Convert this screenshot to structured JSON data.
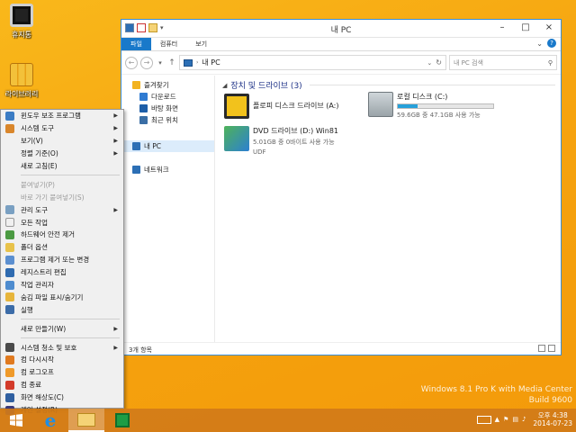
{
  "desktop": {
    "icons": [
      {
        "label": "휴지통",
        "icon": "recycle-bin-icon"
      },
      {
        "label": "라이브러리",
        "icon": "library-icon"
      }
    ],
    "watermark": {
      "line1": "Windows 8.1 Pro K with Media Center",
      "line2": "Build 9600"
    }
  },
  "explorer": {
    "title": "내 PC",
    "ribbon_tabs": [
      "파일",
      "컴퓨터",
      "보기"
    ],
    "help": "?",
    "address_path": "내 PC",
    "search_placeholder": "내 PC 검색",
    "nav": {
      "favorites": "즐겨찾기",
      "downloads": "다운로드",
      "desktop": "바탕 화면",
      "recent": "최근 위치",
      "this_pc": "내 PC",
      "network": "네트워크"
    },
    "section_title": "장치 및 드라이브 (3)",
    "drives": [
      {
        "name": "플로피 디스크 드라이브 (A:)",
        "sub": "",
        "icon": "floppy-drive-icon"
      },
      {
        "name": "로컬 디스크 (C:)",
        "sub": "59.6GB 중 47.1GB 사용 가능",
        "icon": "local-disk-icon",
        "used_fraction": 0.21
      },
      {
        "name": "DVD 드라이브 (D:) Win81",
        "sub": "5.01GB 중 0바이트 사용 가능",
        "sub2": "UDF",
        "icon": "dvd-drive-icon"
      }
    ],
    "status": "3개 항목"
  },
  "context_menu": {
    "groups": [
      [
        {
          "label": "윈도우 보조 프로그램",
          "submenu": true,
          "icon": "accessories-icon"
        },
        {
          "label": "시스템 도구",
          "submenu": true,
          "icon": "system-tools-icon"
        },
        {
          "label": "보기(V)",
          "submenu": true
        },
        {
          "label": "정렬 기준(O)",
          "submenu": true
        },
        {
          "label": "새로 고침(E)"
        }
      ],
      [
        {
          "label": "붙여넣기(P)",
          "disabled": true
        },
        {
          "label": "바로 가기 붙여넣기(S)",
          "disabled": true
        },
        {
          "label": "관리 도구",
          "submenu": true,
          "icon": "admin-tools-icon"
        },
        {
          "label": "모든 작업",
          "icon": "all-tasks-icon"
        },
        {
          "label": "하드웨어 안전 제거",
          "icon": "safely-remove-icon"
        },
        {
          "label": "폴더 옵션",
          "icon": "folder-options-icon"
        },
        {
          "label": "프로그램 제거 또는 변경",
          "icon": "programs-icon"
        },
        {
          "label": "레지스트리 편집",
          "icon": "registry-icon"
        },
        {
          "label": "작업 관리자",
          "icon": "task-manager-icon"
        },
        {
          "label": "숨김 파일 표시/숨기기",
          "icon": "hidden-files-icon"
        },
        {
          "label": "실행",
          "icon": "run-icon"
        }
      ],
      [
        {
          "label": "새로 만들기(W)",
          "submenu": true
        }
      ],
      [
        {
          "label": "시스템 청소 및 보호",
          "submenu": true,
          "icon": "cleanup-icon"
        },
        {
          "label": "컴 다시시작",
          "icon": "restart-icon"
        },
        {
          "label": "컴 로그오프",
          "icon": "logoff-icon"
        },
        {
          "label": "컴 종료",
          "icon": "shutdown-icon"
        },
        {
          "label": "화면 해상도(C)",
          "icon": "display-icon"
        },
        {
          "label": "개인 설정(R)",
          "icon": "personalize-icon"
        }
      ]
    ]
  },
  "taskbar": {
    "buttons": [
      "start-button",
      "ie-button",
      "file-explorer-button",
      "store-button"
    ],
    "clock_time": "오후 4:38",
    "clock_date": "2014-07-23"
  },
  "colors": {
    "desktop_bg": "#f6a40f",
    "accent": "#1979ca",
    "taskbar": "#d17b19",
    "disk_fill": "#26a0da"
  }
}
